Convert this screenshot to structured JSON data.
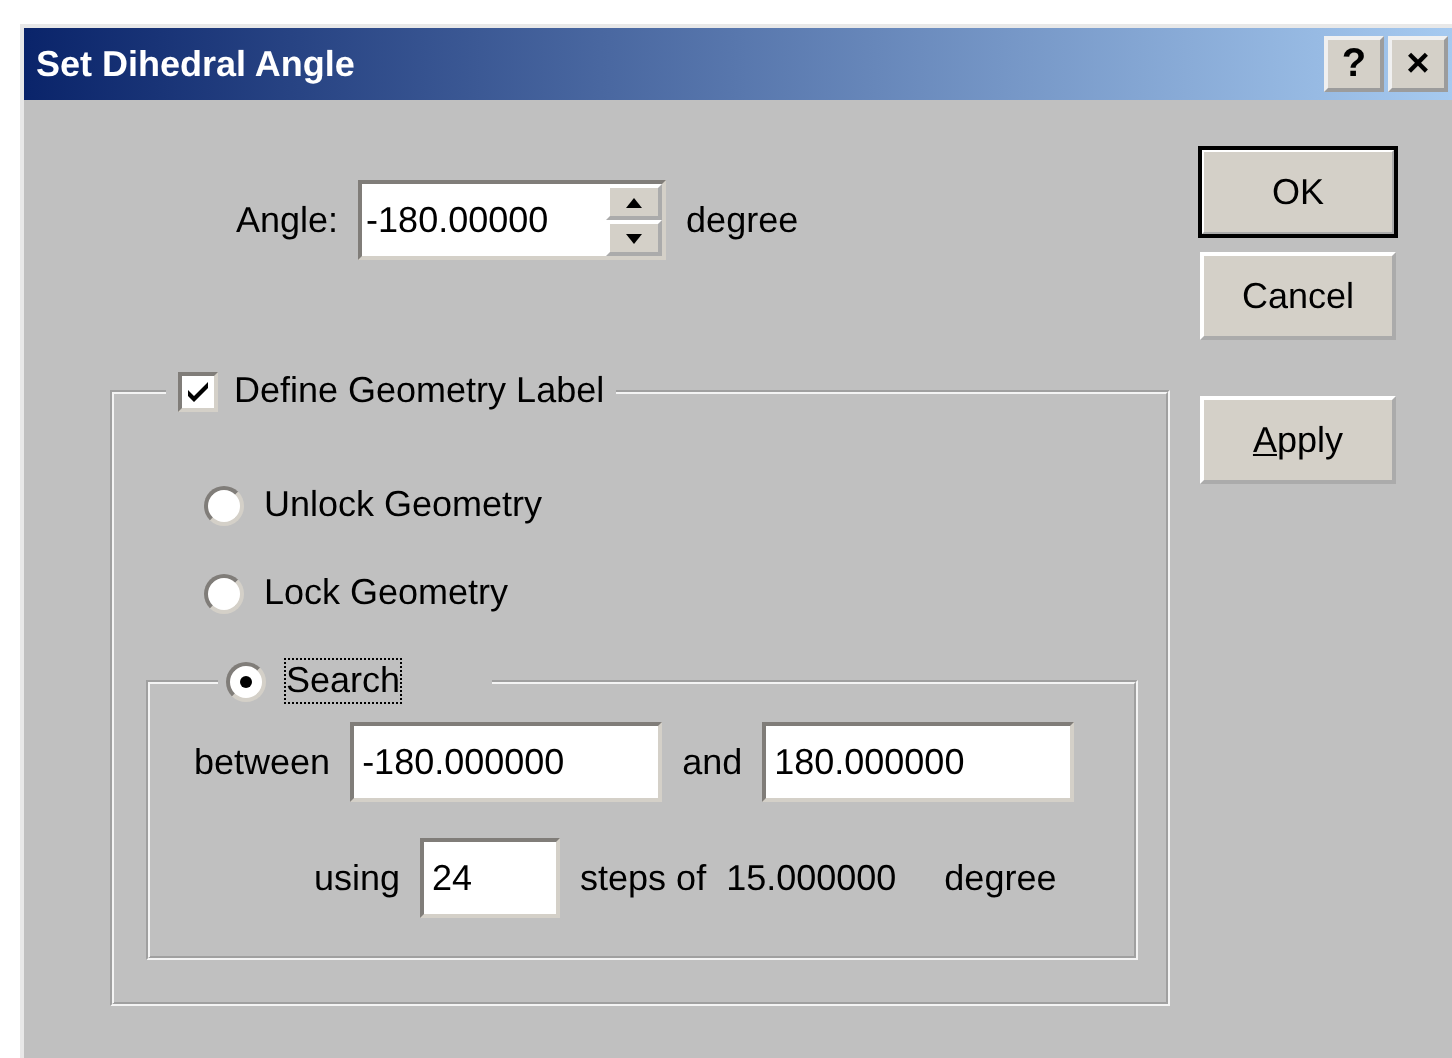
{
  "window": {
    "title": "Set Dihedral Angle",
    "title_buttons": [
      "?",
      "×"
    ]
  },
  "angle": {
    "label": "Angle:",
    "value": "-180.00000",
    "unit": "degree"
  },
  "buttons": [
    {
      "label": "OK",
      "default": true,
      "underline_first": false
    },
    {
      "label": "Cancel",
      "default": false,
      "underline_first": false
    },
    {
      "label": "Apply",
      "default": false,
      "underline_first": true
    }
  ],
  "geometry": {
    "checkbox": {
      "label": "Define Geometry Label",
      "checked": true
    },
    "options": [
      {
        "label": "Unlock Geometry",
        "selected": false,
        "focused": false
      },
      {
        "label": "Lock Geometry",
        "selected": false,
        "focused": false
      },
      {
        "label": "Search",
        "selected": true,
        "focused": true
      }
    ],
    "search": {
      "between_label": "between",
      "from": "-180.000000",
      "and_label": "and",
      "to": "180.000000",
      "using_label": "using",
      "steps": "24",
      "steps_label": "steps of",
      "step_size": "15.000000",
      "unit": "degree"
    }
  }
}
